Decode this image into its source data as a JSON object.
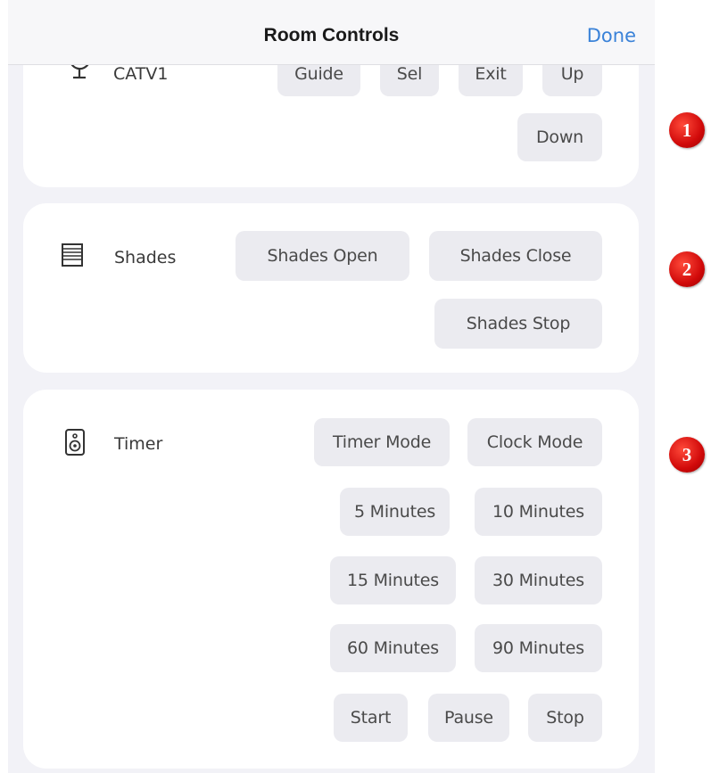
{
  "header": {
    "title": "Room Controls",
    "done_label": "Done"
  },
  "sections": {
    "catv": {
      "icon": "satellite-dish-icon",
      "label": "CATV1",
      "buttons": [
        "Guide",
        "Sel",
        "Exit",
        "Up",
        "Down"
      ]
    },
    "shades": {
      "icon": "window-shades-icon",
      "label": "Shades",
      "buttons": [
        "Shades Open",
        "Shades Close",
        "Shades Stop"
      ]
    },
    "timer": {
      "icon": "speaker-icon",
      "label": "Timer",
      "buttons": [
        "Timer Mode",
        "Clock Mode",
        "5 Minutes",
        "10 Minutes",
        "15 Minutes",
        "30 Minutes",
        "60 Minutes",
        "90 Minutes",
        "Start",
        "Pause",
        "Stop"
      ]
    }
  },
  "callouts": [
    "1",
    "2",
    "3"
  ],
  "colors": {
    "accent": "#3a82d8",
    "callout": "#d10a0a",
    "button_bg": "#ebebf0",
    "panel_bg": "#f2f2f7"
  }
}
